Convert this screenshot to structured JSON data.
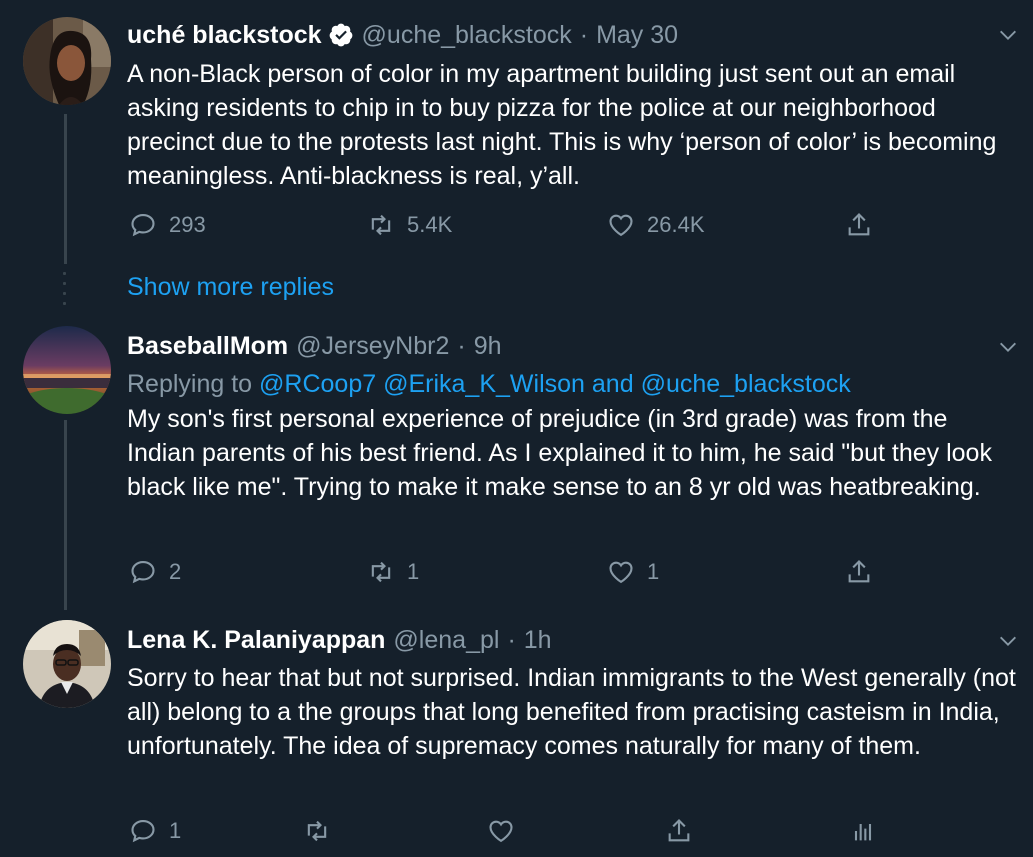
{
  "tweets": [
    {
      "name": "uché blackstock",
      "handle": "@uche_blackstock",
      "time": "May 30",
      "verified": true,
      "text": "A non-Black person of color in my apartment building just sent out an email asking residents to chip in to buy pizza for the police at our neighborhood precinct due to the protests last night. This is why ‘person of color’ is becoming meaningless. Anti-blackness is real, y’all.",
      "replies": "293",
      "retweets": "5.4K",
      "likes": "26.4K"
    },
    {
      "name": "BaseballMom",
      "handle": "@JerseyNbr2",
      "time": "9h",
      "reply_prefix": "Replying to",
      "reply_mentions": [
        "@RCoop7",
        "@Erika_K_Wilson",
        "@uche_blackstock"
      ],
      "reply_and": "and",
      "text": "My son's first personal experience of prejudice (in 3rd grade) was from the Indian parents of his best friend. As I explained it to him, he said \"but they look black like me\". Trying to make it make sense to an 8 yr old was heatbreaking.",
      "replies": "2",
      "retweets": "1",
      "likes": "1"
    },
    {
      "name": "Lena K. Palaniyappan",
      "handle": "@lena_pl",
      "time": "1h",
      "text": "Sorry to hear that but not surprised. Indian immigrants to the West generally (not all) belong to a the groups that long benefited from practising casteism in India, unfortunately. The idea of supremacy comes naturally for many of them.",
      "replies": "1"
    }
  ],
  "show_more": "Show more replies",
  "separator": "·",
  "colors": {
    "background": "#15202b",
    "secondary_text": "#8899a6",
    "accent": "#1da1f2",
    "thread_line": "#38444d"
  },
  "icons": {
    "reply": "reply-icon",
    "retweet": "retweet-icon",
    "like": "heart-icon",
    "share": "share-icon",
    "analytics": "analytics-icon",
    "menu": "chevron-down-icon"
  }
}
